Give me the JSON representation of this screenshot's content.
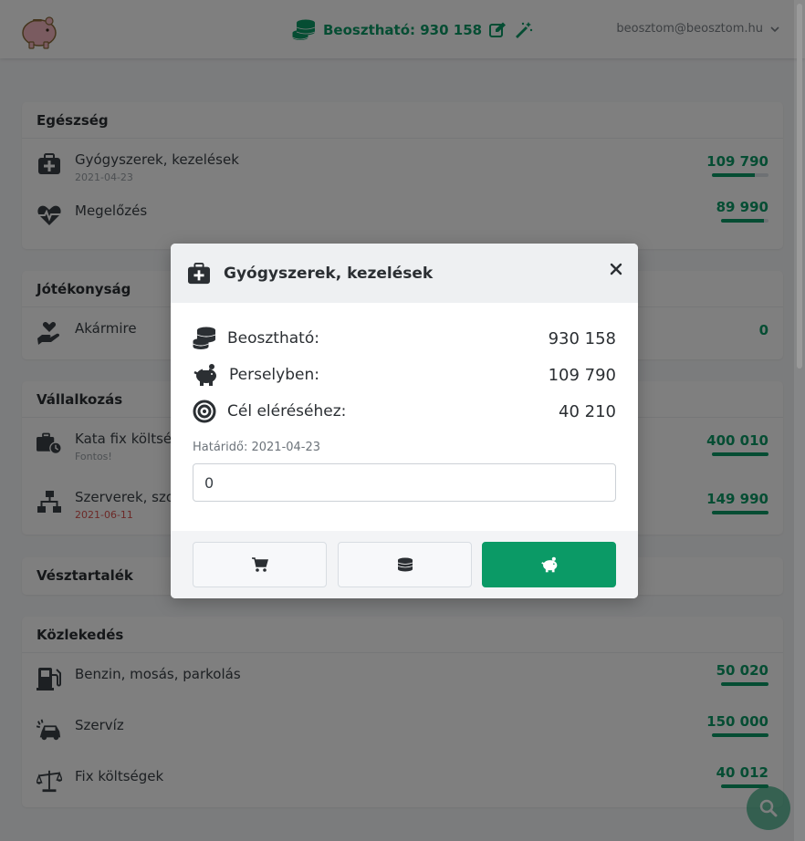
{
  "header": {
    "available_label": "Beosztható: 930 158",
    "user_email": "beosztom@beosztom.hu"
  },
  "sections": [
    {
      "title": "Egészség",
      "items": [
        {
          "name": "Gyógyszerek, kezelések",
          "sub": "2021-04-23",
          "value": "109 790",
          "progress": 0.75
        },
        {
          "name": "Megelőzés",
          "sub": "",
          "value": "89 990",
          "progress": 0.9
        }
      ]
    },
    {
      "title": "Jótékonyság",
      "items": [
        {
          "name": "Akármire",
          "sub": "",
          "value": "0",
          "progress": 0
        }
      ]
    },
    {
      "title": "Vállalkozás",
      "items": [
        {
          "name": "Kata fix költség",
          "sub": "Fontos!",
          "value": "400 010",
          "progress": 1.0
        },
        {
          "name": "Szerverek, szol",
          "sub": "2021-06-11",
          "value": "149 990",
          "progress": 1.0
        }
      ]
    },
    {
      "title": "Vésztartalék",
      "items": []
    },
    {
      "title": "Közlekedés",
      "items": [
        {
          "name": "Benzin, mosás, parkolás",
          "sub": "",
          "value": "50 020",
          "progress": 1.0
        },
        {
          "name": "Szervíz",
          "sub": "",
          "value": "150 000",
          "progress": 1.0
        },
        {
          "name": "Fix költségek",
          "sub": "",
          "value": "40 012",
          "progress": 1.0
        }
      ]
    }
  ],
  "modal": {
    "title": "Gyógyszerek, kezelések",
    "lines": [
      {
        "label": "Beosztható:",
        "value": "930 158",
        "icon": "coins-icon"
      },
      {
        "label": "Perselyben:",
        "value": "109 790",
        "icon": "piggy-bank-icon"
      },
      {
        "label": "Cél eléréséhez:",
        "value": "40 210",
        "icon": "target-icon"
      }
    ],
    "deadline": "Határidő: 2021-04-23",
    "amount_value": "0"
  },
  "colors": {
    "accent": "#0b9a66",
    "overlay": "rgba(0,0,0,0.5)"
  }
}
